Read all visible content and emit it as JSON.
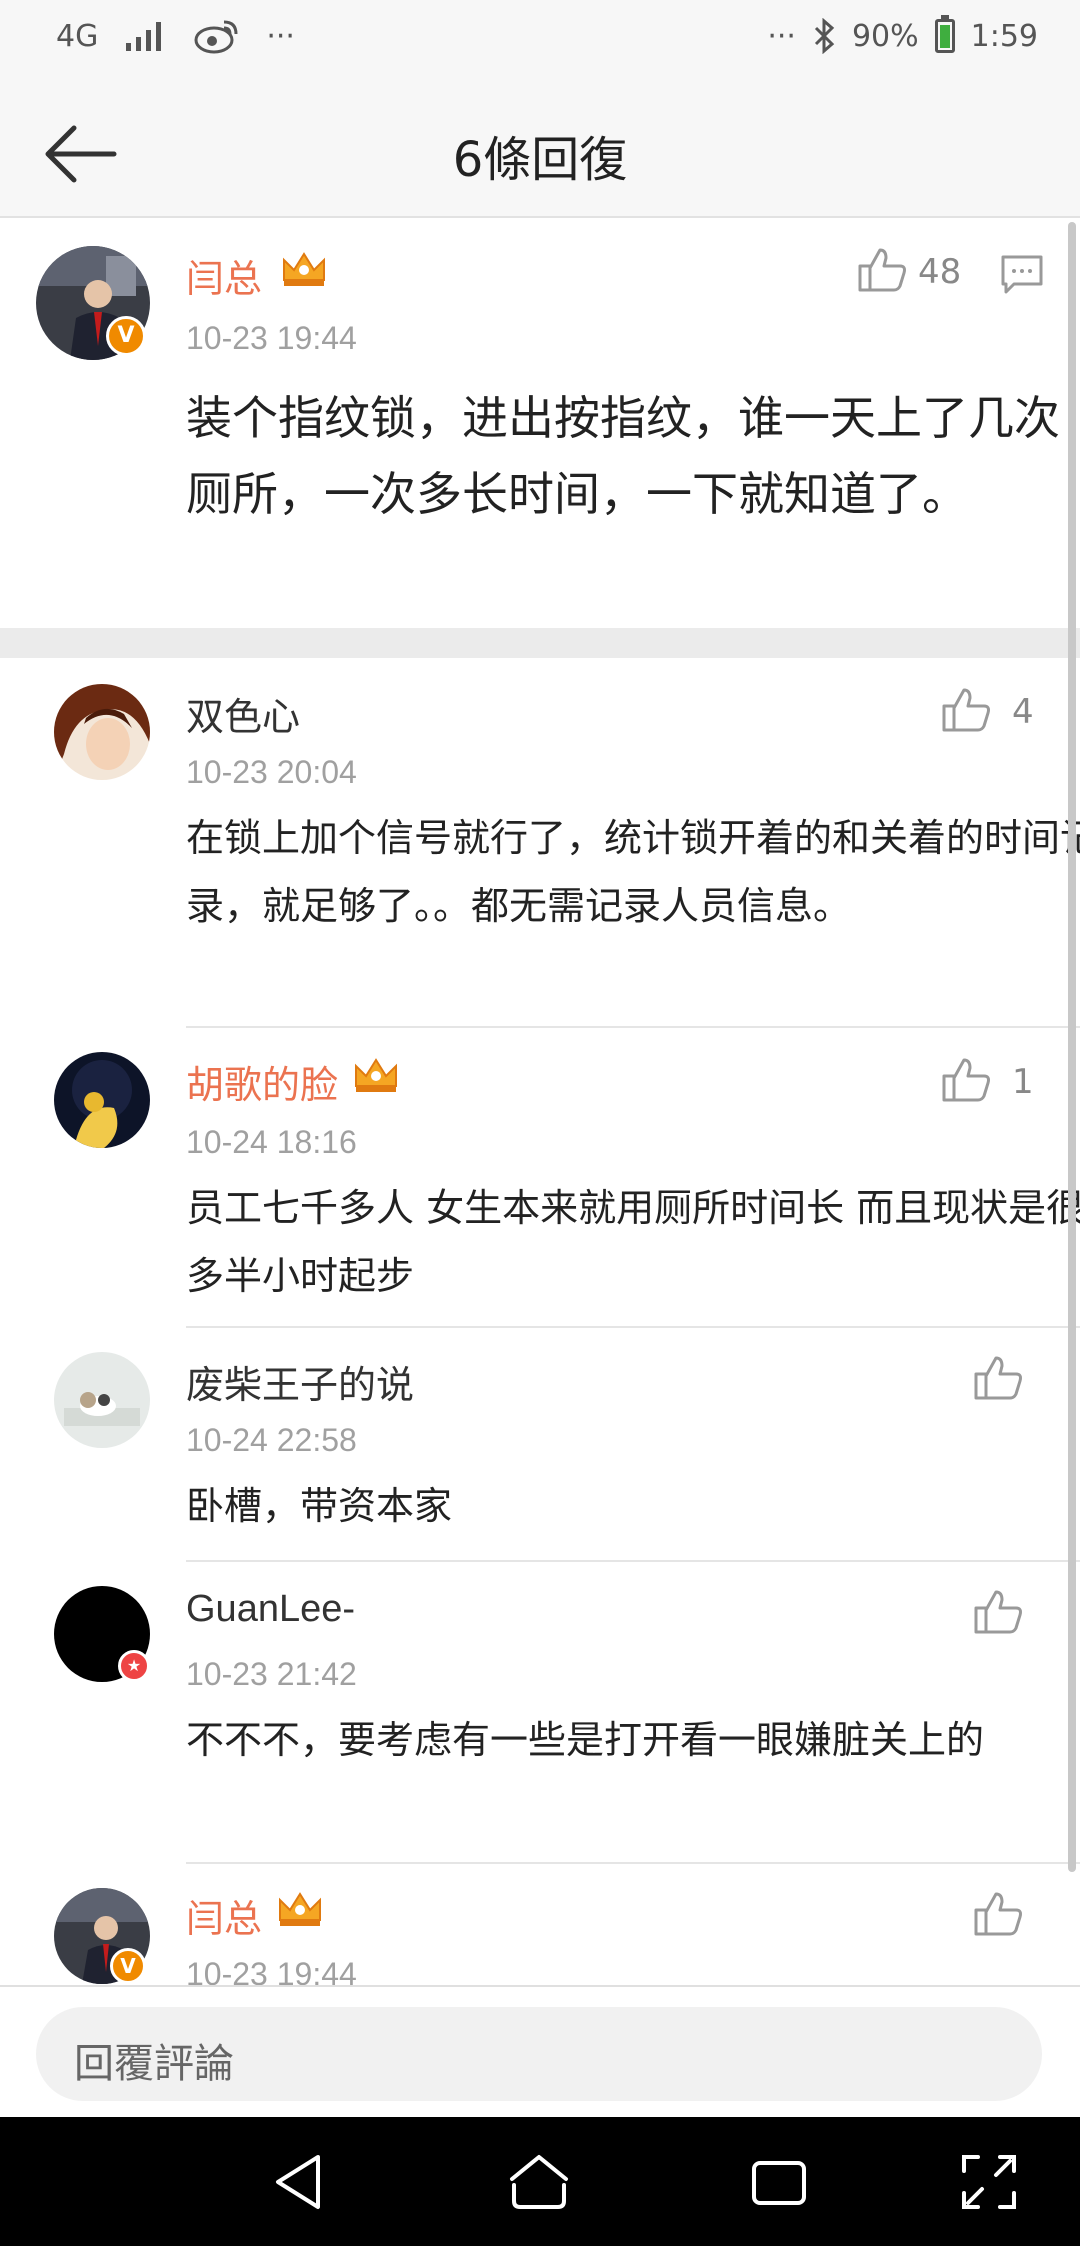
{
  "status_bar": {
    "network": "4G",
    "battery": "90%",
    "battery_level": 0.9,
    "time": "1:59",
    "dots": "···"
  },
  "header": {
    "title": "6條回復",
    "back_icon": "back-arrow-icon"
  },
  "main_comment": {
    "user": "闫总",
    "time": "10-23 19:44",
    "likes": "48",
    "text": "装个指纹锁，进出按指纹，谁一天上了几次厕所，一次多长时间，一下就知道了。",
    "verified": "V"
  },
  "replies": [
    {
      "user": "双色心",
      "vip": false,
      "time": "10-23 20:04",
      "likes": "4",
      "text": "在锁上加个信号就行了，统计锁开着的和关着的时间记录，就足够了。。都无需记录人员信息。"
    },
    {
      "user": "胡歌的脸",
      "vip": true,
      "time": "10-24 18:16",
      "likes": "1",
      "text": "员工七千多人  女生本来就用厕所时间长 而且现状是很多半小时起步"
    },
    {
      "user": "废柴王子的说",
      "vip": false,
      "time": "10-24 22:58",
      "likes": "",
      "text": "卧槽，带资本家"
    },
    {
      "user": "GuanLee-",
      "vip": false,
      "time": "10-23 21:42",
      "likes": "",
      "text": "不不不，要考虑有一些是打开看一眼嫌脏关上的"
    },
    {
      "user": "闫总",
      "vip": true,
      "time": "10-23 19:44",
      "likes": "",
      "text": ""
    }
  ],
  "reply_input": {
    "placeholder": "回覆評論"
  },
  "colors": {
    "vip_name": "#eb7350",
    "crown": "#f5a623",
    "muted": "#a0a0a0"
  }
}
